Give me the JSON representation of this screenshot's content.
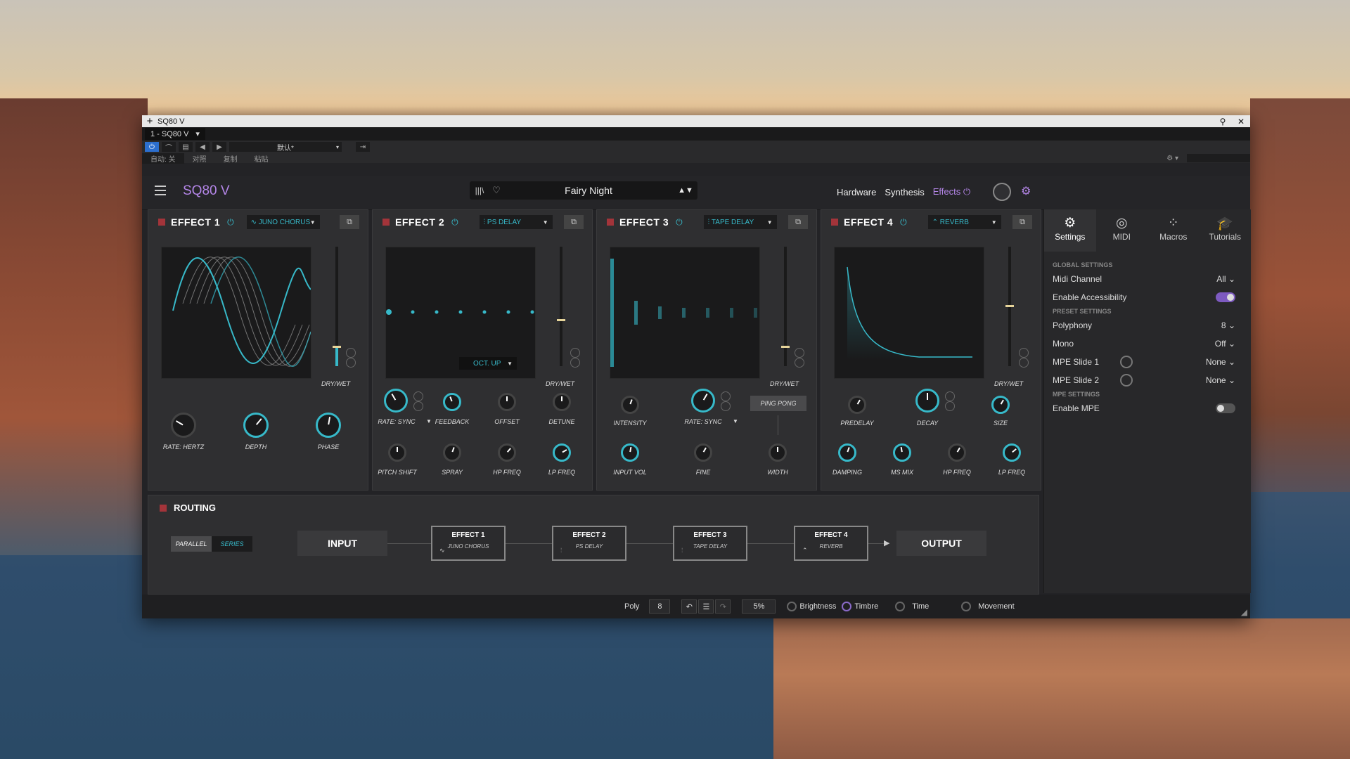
{
  "window": {
    "title": "SQ80 V",
    "plus": "+",
    "pin_icon": "pin-icon",
    "close_icon": "close-icon"
  },
  "host": {
    "track": "1 - SQ80 V",
    "preset_dd": "默认*",
    "auto": "自动: 关",
    "compare": "对照",
    "copy": "复制",
    "paste": "粘贴"
  },
  "app": {
    "title": "SQ80 V",
    "preset_name": "Fairy Night",
    "tabs": {
      "hardware": "Hardware",
      "synthesis": "Synthesis",
      "effects": "Effects"
    },
    "accent": "#b486e8",
    "cyan": "#37b9c9"
  },
  "effects": [
    {
      "title": "EFFECT 1",
      "type": "JUNO CHORUS",
      "drywet": "DRY/WET",
      "knobs": [
        "RATE: HERTZ",
        "DEPTH",
        "PHASE"
      ],
      "drywet_level": 0.16
    },
    {
      "title": "EFFECT 2",
      "type": "PS DELAY",
      "drywet": "DRY/WET",
      "mode": "OCT. UP",
      "knobs_row1": [
        "RATE: SYNC",
        "FEEDBACK",
        "OFFSET",
        "DETUNE"
      ],
      "knobs_row2": [
        "PITCH SHIFT",
        "SPRAY",
        "HP FREQ",
        "LP FREQ"
      ],
      "drywet_level": 0.27
    },
    {
      "title": "EFFECT 3",
      "type": "TAPE DELAY",
      "drywet": "DRY/WET",
      "ping": "PING PONG",
      "knobs_row1": [
        "INTENSITY",
        "RATE: SYNC"
      ],
      "knobs_row2": [
        "INPUT VOL",
        "FINE",
        "WIDTH"
      ],
      "drywet_level": 0.16
    },
    {
      "title": "EFFECT 4",
      "type": "REVERB",
      "drywet": "DRY/WET",
      "knobs_row1": [
        "PREDELAY",
        "DECAY",
        "SIZE"
      ],
      "knobs_row2": [
        "DAMPING",
        "MS MIX",
        "HP FREQ",
        "LP FREQ"
      ],
      "drywet_level": 0.5
    }
  ],
  "routing": {
    "title": "ROUTING",
    "parallel": "PARALLEL",
    "series": "SERIES",
    "input": "INPUT",
    "output": "OUTPUT",
    "chain": [
      {
        "title": "EFFECT 1",
        "sub": "JUNO CHORUS"
      },
      {
        "title": "EFFECT 2",
        "sub": "PS DELAY"
      },
      {
        "title": "EFFECT 3",
        "sub": "TAPE DELAY"
      },
      {
        "title": "EFFECT 4",
        "sub": "REVERB"
      }
    ]
  },
  "side": {
    "tabs": [
      "Settings",
      "MIDI",
      "Macros",
      "Tutorials"
    ],
    "global": "GLOBAL SETTINGS",
    "midi_channel": "Midi Channel",
    "midi_channel_v": "All",
    "accessibility": "Enable Accessibility",
    "preset": "PRESET SETTINGS",
    "polyphony": "Polyphony",
    "polyphony_v": "8",
    "mono": "Mono",
    "mono_v": "Off",
    "mpe1": "MPE Slide 1",
    "mpe1_v": "None",
    "mpe2": "MPE Slide 2",
    "mpe2_v": "None",
    "mpe": "MPE SETTINGS",
    "enable_mpe": "Enable MPE"
  },
  "bottom": {
    "poly": "Poly",
    "poly_v": "8",
    "zoom": "5%",
    "brightness": "Brightness",
    "timbre": "Timbre",
    "time": "Time",
    "movement": "Movement"
  }
}
